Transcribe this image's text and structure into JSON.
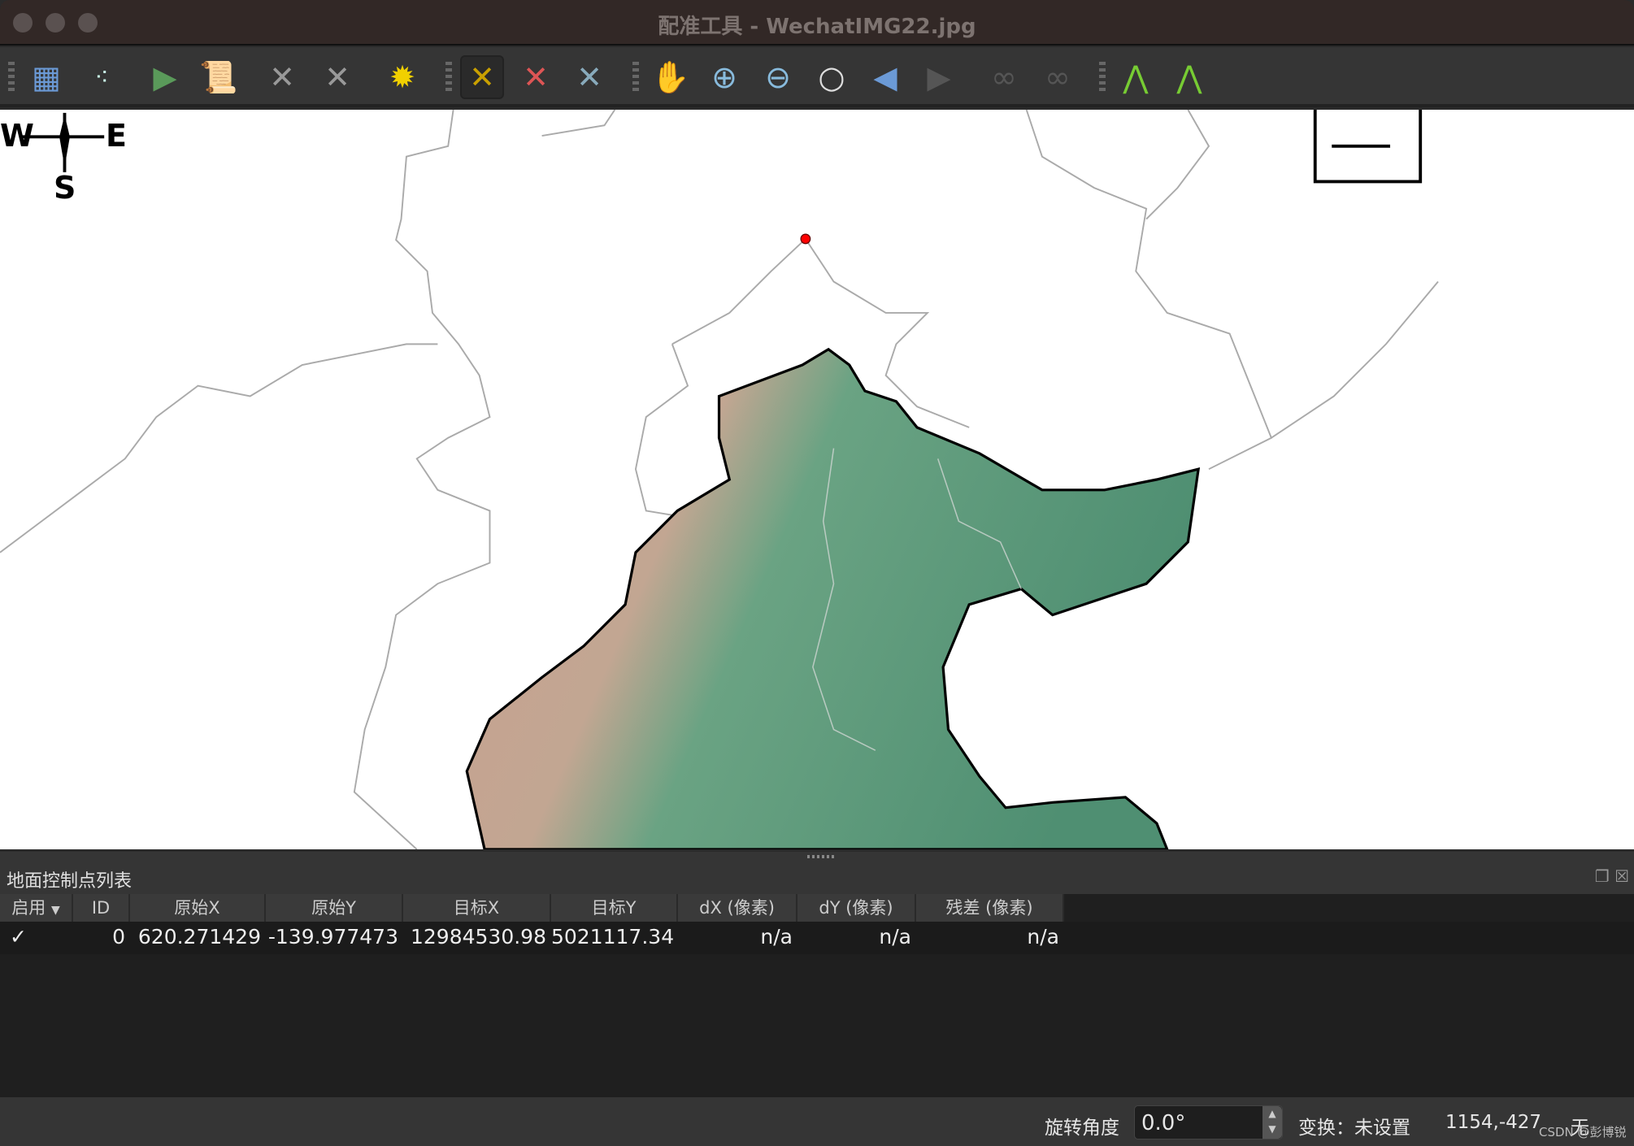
{
  "window": {
    "title": "配准工具 - WechatIMG22.jpg"
  },
  "toolbar": {
    "buttons": [
      {
        "name": "open-raster",
        "icon": "raster-add-icon"
      },
      {
        "name": "add-point",
        "icon": "points-add-icon"
      },
      {
        "name": "start-georeferencing",
        "icon": "play-icon"
      },
      {
        "name": "generate-gdal-script",
        "icon": "script-icon"
      },
      {
        "name": "load-gcp",
        "icon": "gcp-load-icon"
      },
      {
        "name": "save-gcp",
        "icon": "gcp-save-icon"
      },
      {
        "name": "transformation-settings",
        "icon": "gear-icon"
      },
      {
        "name": "add-gcp",
        "icon": "gcp-add-icon"
      },
      {
        "name": "delete-gcp",
        "icon": "gcp-delete-icon"
      },
      {
        "name": "move-gcp",
        "icon": "gcp-move-icon"
      },
      {
        "name": "pan",
        "icon": "hand-icon"
      },
      {
        "name": "zoom-in",
        "icon": "zoom-in-icon"
      },
      {
        "name": "zoom-out",
        "icon": "zoom-out-icon"
      },
      {
        "name": "zoom-to-layer",
        "icon": "zoom-full-icon"
      },
      {
        "name": "zoom-last",
        "icon": "zoom-last-icon"
      },
      {
        "name": "zoom-next",
        "icon": "zoom-next-icon"
      },
      {
        "name": "link-georef-to-qgis",
        "icon": "link-icon"
      },
      {
        "name": "link-qgis-to-georef",
        "icon": "link-icon"
      },
      {
        "name": "histogram-stretch",
        "icon": "histogram-stretch-icon"
      },
      {
        "name": "histogram-full",
        "icon": "histogram-icon"
      }
    ]
  },
  "map": {
    "compass": {
      "w": "W",
      "e": "E",
      "s": "S"
    },
    "colors": {
      "gcp_marker": "#ff0000",
      "terrain_low": "#5f9e7c",
      "terrain_high": "#c9a08f"
    }
  },
  "gcp_panel": {
    "title": "地面控制点列表",
    "columns": [
      "启用",
      "ID",
      "原始X",
      "原始Y",
      "目标X",
      "目标Y",
      "dX (像素)",
      "dY (像素)",
      "残差 (像素)"
    ],
    "rows": [
      {
        "enabled": "✓",
        "id": "0",
        "src_x": "620.271429",
        "src_y": "-139.977473",
        "dst_x": "12984530.98",
        "dst_y": "5021117.34",
        "dx": "n/a",
        "dy": "n/a",
        "residual": "n/a"
      }
    ]
  },
  "status": {
    "rotation_label": "旋转角度",
    "rotation_value": "0.0°",
    "transform": "变换：未设置",
    "coords": "1154,-427",
    "crs": "无",
    "watermark": "CSDN @彭博锐"
  }
}
